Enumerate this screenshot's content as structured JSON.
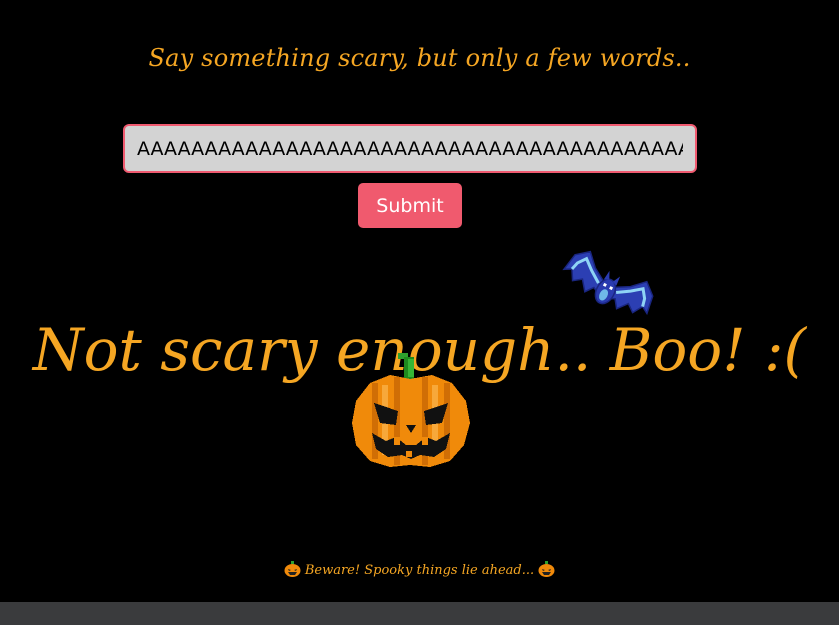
{
  "prompt": "Say something scary, but only a few words..",
  "input": {
    "value": "AAAAAAAAAAAAAAAAAAAAAAAAAAAAAAAAAAAAAAAAAAAAAAAAAAAAAAAAAAA",
    "placeholder": ""
  },
  "submit_label": "Submit",
  "result_message": "Not scary enough.. Boo! :(",
  "footer": {
    "text": "Beware! Spooky things lie ahead...",
    "left_icon": "pumpkin-icon",
    "right_icon": "pumpkin-icon"
  },
  "icons": {
    "bat": "bat-icon",
    "pumpkin": "jack-o-lantern-icon"
  },
  "colors": {
    "background": "#000000",
    "accent_text": "#f5a623",
    "button": "#f05a6e",
    "input_border": "#f05a70",
    "input_background": "#d3d3d3",
    "bottom_bar": "#3a3b3d"
  }
}
